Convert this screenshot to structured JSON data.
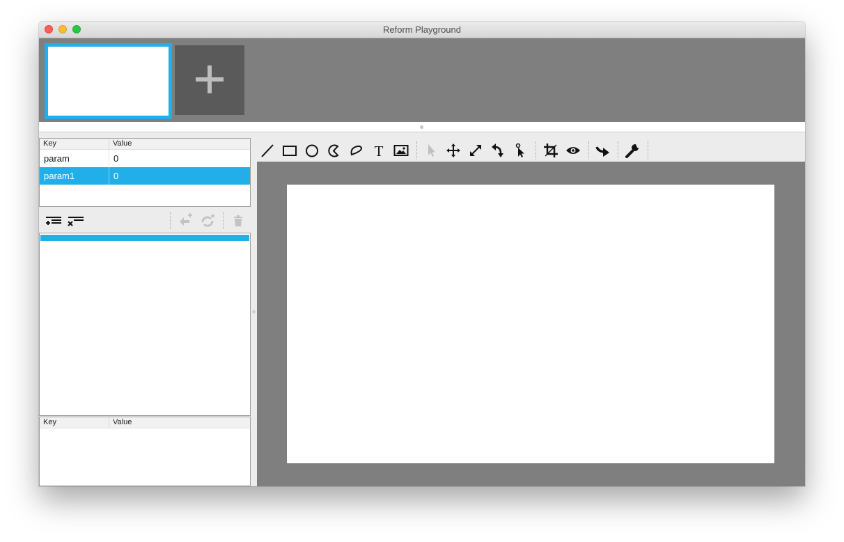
{
  "window": {
    "title": "Reform Playground"
  },
  "colors": {
    "accent": "#21aee9",
    "panel_bg": "#7f7f7f",
    "add_button": "#5a5a5a"
  },
  "slides": {
    "items": [
      {
        "selected": true
      }
    ],
    "add_icon": "plus-icon"
  },
  "params_table": {
    "headers": {
      "key": "Key",
      "value": "Value"
    },
    "rows": [
      {
        "key": "param",
        "value": "0",
        "selected": false
      },
      {
        "key": "param1",
        "value": "0",
        "selected": true
      }
    ]
  },
  "list_toolbar": {
    "icons": [
      "add-constraint-icon",
      "remove-constraint-icon",
      "add-loop-icon",
      "add-refresh-icon",
      "trash-icon"
    ]
  },
  "bottom_table": {
    "headers": {
      "key": "Key",
      "value": "Value"
    }
  },
  "toolbar": {
    "groups": [
      [
        "line-tool-icon",
        "rectangle-tool-icon",
        "circle-tool-icon",
        "pie-tool-icon",
        "freeform-tool-icon",
        "text-tool-icon",
        "image-tool-icon"
      ],
      [
        "select-tool-icon",
        "move-tool-icon",
        "scale-tool-icon",
        "rotate-tool-icon",
        "morph-tool-icon"
      ],
      [
        "crop-tool-icon",
        "preview-eye-icon"
      ],
      [
        "redo-arrow-icon"
      ],
      [
        "settings-wrench-icon"
      ]
    ]
  }
}
